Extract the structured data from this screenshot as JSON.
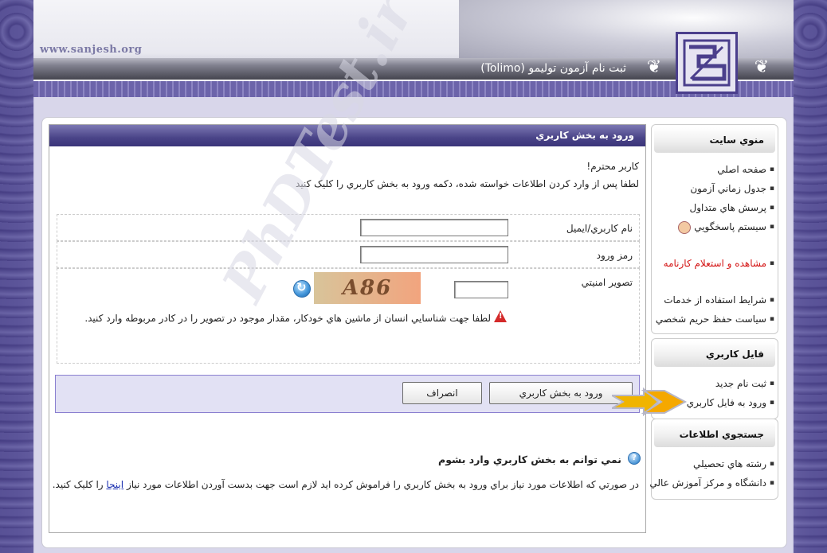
{
  "header": {
    "site_url": "www.sanjesh.org",
    "title": "ثبت نام آزمون توليمو (Tolimo)"
  },
  "login": {
    "panel_title": "ورود به بخش کاربري",
    "greeting": "کاربر محترم!",
    "instruction": "لطفا پس از وارد کردن اطلاعات خواسته شده، دکمه ورود به بخش کاربري را کليک کنيد",
    "username_label": "نام کاربري/ايميل",
    "username_value": "",
    "password_label": "رمز ورود",
    "password_value": "",
    "captcha_label": "تصوير امنيتي",
    "captcha_text": "A86",
    "captcha_value": "",
    "captcha_note": "لطفا جهت شناسايي انسان از ماشين هاي خودکار، مقدار موجود در تصوير را در کادر مربوطه وارد کنيد.",
    "submit_label": "ورود به بخش کاربري",
    "cancel_label": "انصراف"
  },
  "help": {
    "title": "نمي توانم به بخش کاربري وارد بشوم",
    "text_before": "در صورتي که اطلاعات مورد نياز براي ورود به بخش کاربري را فراموش کرده ايد لازم است جهت بدست آوردن اطلاعات مورد نياز",
    "link": "اينجا",
    "text_after": "را کليک کنيد."
  },
  "watermark": "PhDTest.ir",
  "sidebar": {
    "site_menu_title": "منوي سايت",
    "site_menu": [
      {
        "label": "صفحه اصلي"
      },
      {
        "label": "جدول زماني آزمون"
      },
      {
        "label": "پرسش هاي متداول"
      },
      {
        "label": "سيستم پاسخگويي"
      },
      {
        "label": "مشاهده و استعلام کارنامه"
      },
      {
        "label": "شرايط استفاده از خدمات"
      },
      {
        "label": "سياست حفظ حريم شخصي"
      }
    ],
    "user_file_title": "فايل کاربري",
    "user_file": [
      {
        "label": "ثبت نام جديد"
      },
      {
        "label": "ورود به فايل کاربري"
      }
    ],
    "info_search_title": "جستجوي اطلاعات",
    "info_search": [
      {
        "label": "رشته هاي تحصيلي"
      },
      {
        "label": "دانشگاه و مرکز آموزش عالي"
      }
    ]
  },
  "colors": {
    "accent": "#4a4488",
    "link": "#1a2fb0",
    "alert": "#d41515",
    "button_bar": "#e2e1f4"
  }
}
